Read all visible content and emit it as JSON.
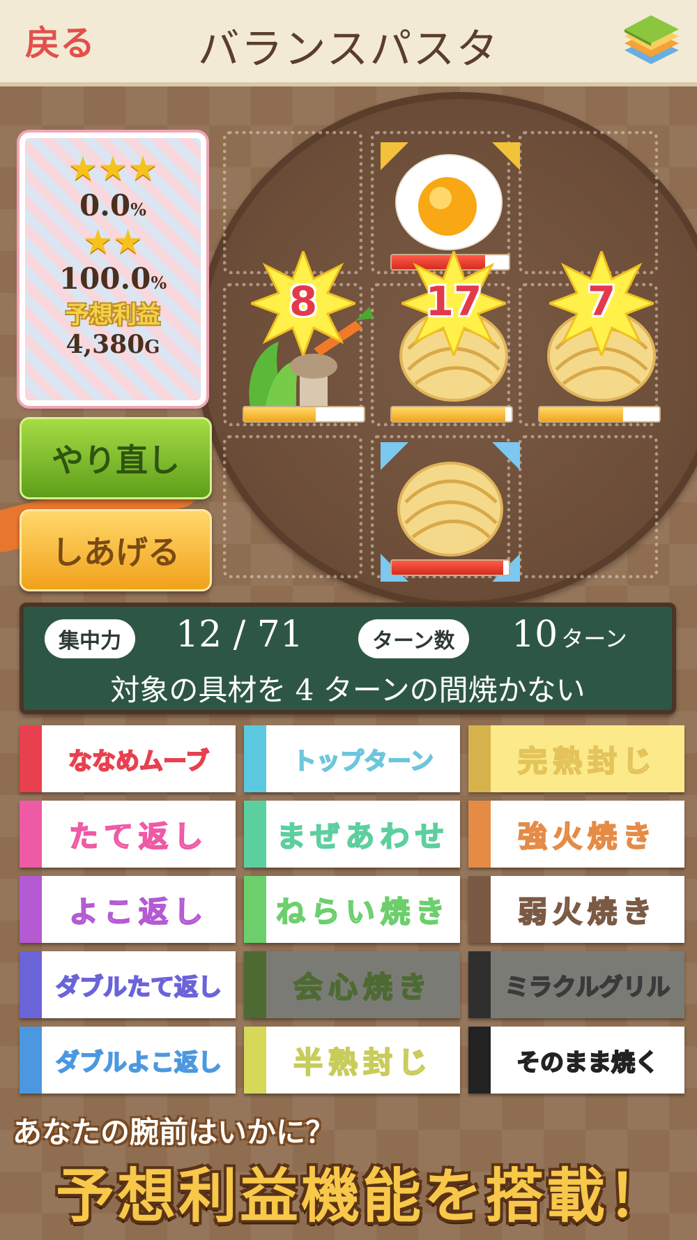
{
  "header": {
    "back_label": "戻る",
    "title": "バランスパスタ",
    "menu_icon": "layered-book-icon"
  },
  "score_card": {
    "three_star_pct": "0.0",
    "two_star_pct": "100.0",
    "pct_sign": "%",
    "profit_label": "予想利益",
    "profit_value": "4,380",
    "profit_unit": "G"
  },
  "buttons": {
    "redo": "やり直し",
    "finish": "しあげる"
  },
  "grid": {
    "egg": {
      "icon": "fried-egg-icon",
      "heat": 0.8
    },
    "veg": {
      "icon": "vegetables-icon",
      "count": "8",
      "heat": 0.6
    },
    "pasta_mid": {
      "icon": "pasta-icon",
      "count": "17",
      "heat": 0.95
    },
    "pasta_right": {
      "icon": "pasta-icon",
      "count": "7",
      "heat": 0.7
    },
    "pasta_bottom": {
      "icon": "pasta-icon",
      "heat": 0.95
    }
  },
  "board": {
    "focus_label": "集中力",
    "focus_value": "12 / 71",
    "turns_label": "ターン数",
    "turns_value": "10",
    "turns_unit": "ターン",
    "message": "対象の具材を 4 ターンの間焼かない"
  },
  "skills": [
    {
      "label": "ななめムーブ",
      "color": "#e8404e",
      "text": "#e8404e"
    },
    {
      "label": "トップターン",
      "color": "#5cc8e0",
      "text": "#6cc6dc"
    },
    {
      "label": "完熟封じ",
      "color": "#d6b24c",
      "text": "#e3c35a"
    },
    {
      "label": "たて返し",
      "color": "#ee5aa5",
      "text": "#ee5aa5"
    },
    {
      "label": "まぜあわせ",
      "color": "#5ccf9e",
      "text": "#5ccf9e"
    },
    {
      "label": "強火焼き",
      "color": "#e58b46",
      "text": "#e58b46"
    },
    {
      "label": "よこ返し",
      "color": "#b45ad3",
      "text": "#b45ad3"
    },
    {
      "label": "ねらい焼き",
      "color": "#6ccf6c",
      "text": "#6ccf6c"
    },
    {
      "label": "弱火焼き",
      "color": "#7b5a45",
      "text": "#7b5a45"
    },
    {
      "label": "ダブルたて返し",
      "color": "#6b63d8",
      "text": "#6b63d8"
    },
    {
      "label": "会心焼き",
      "color": "#4d6a32",
      "text": "#4d6a32"
    },
    {
      "label": "ミラクルグリル",
      "color": "#2f2f2f",
      "text": "#3a3a3a"
    },
    {
      "label": "ダブルよこ返し",
      "color": "#4c98e0",
      "text": "#4c98e0"
    },
    {
      "label": "半熟封じ",
      "color": "#d6d85a",
      "text": "#c8cc5a"
    },
    {
      "label": "そのまま焼く",
      "color": "#222222",
      "text": "#222222"
    }
  ],
  "promo": {
    "line1": "あなたの腕前はいかに？",
    "line2": "予想利益機能を搭載！"
  }
}
